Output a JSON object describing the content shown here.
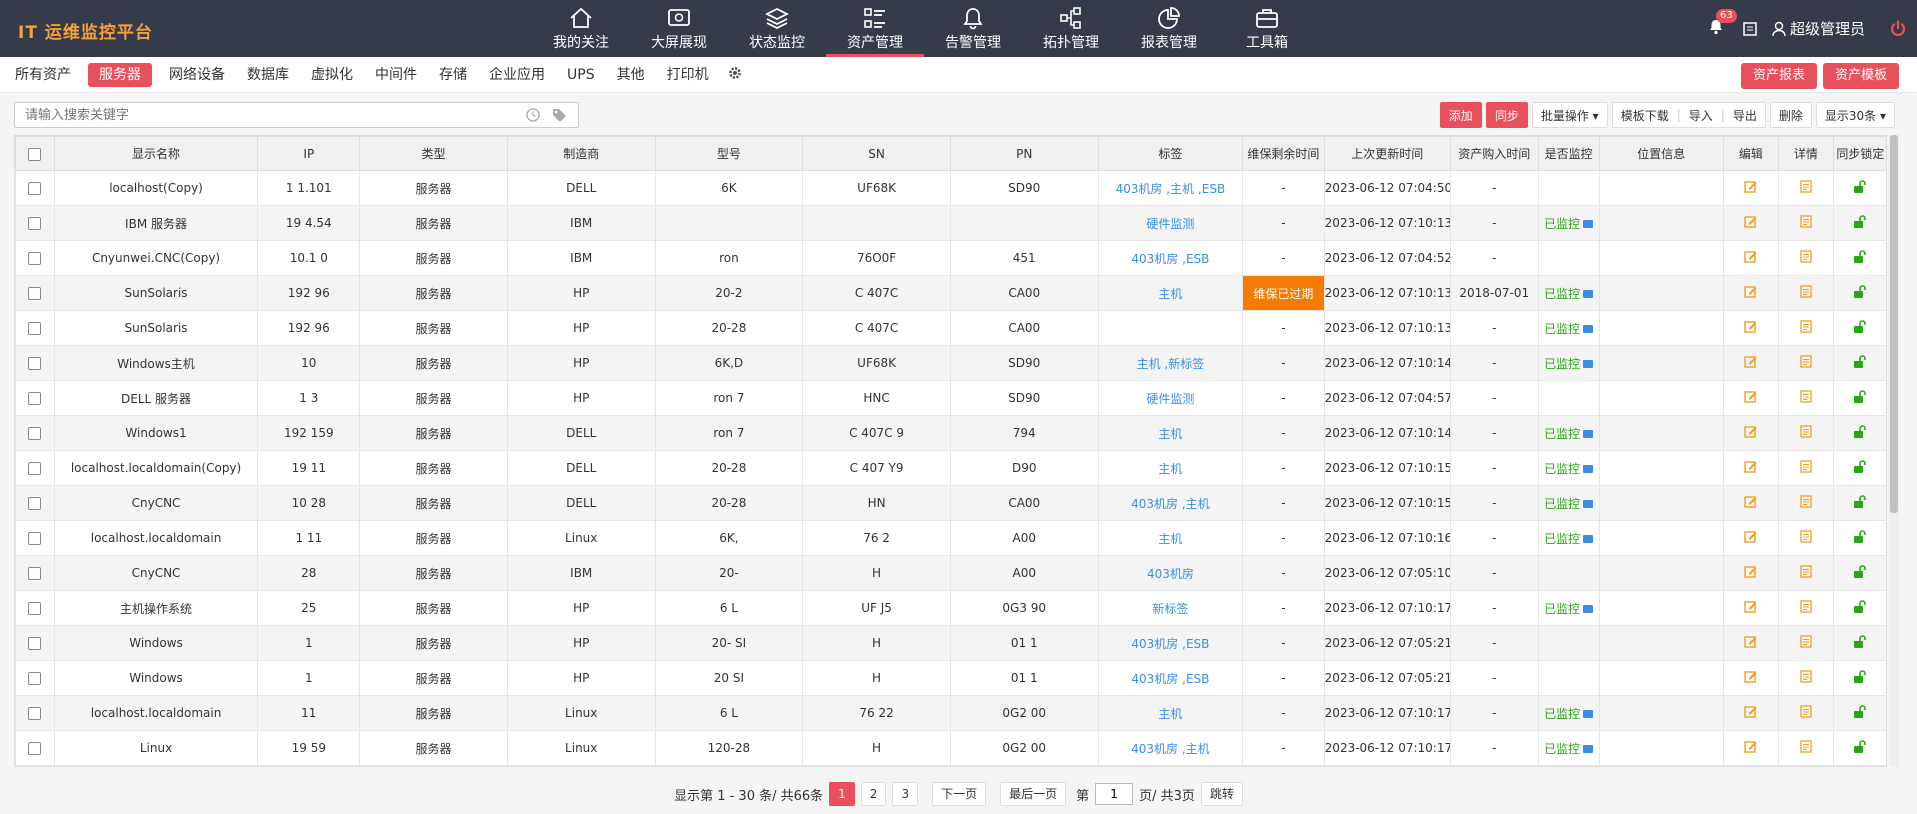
{
  "app": {
    "title": "IT 运维监控平台"
  },
  "nav": [
    {
      "label": "我的关注",
      "icon": "home-icon"
    },
    {
      "label": "大屏展现",
      "icon": "screen-icon"
    },
    {
      "label": "状态监控",
      "icon": "layers-icon"
    },
    {
      "label": "资产管理",
      "icon": "list-icon",
      "active": true
    },
    {
      "label": "告警管理",
      "icon": "bell-icon"
    },
    {
      "label": "拓扑管理",
      "icon": "topology-icon"
    },
    {
      "label": "报表管理",
      "icon": "pie-icon"
    },
    {
      "label": "工具箱",
      "icon": "toolbox-icon"
    }
  ],
  "header": {
    "alert_count": "63",
    "user_name": "超级管理员"
  },
  "categories": [
    "所有资产",
    "服务器",
    "网络设备",
    "数据库",
    "虚拟化",
    "中间件",
    "存储",
    "企业应用",
    "UPS",
    "其他",
    "打印机"
  ],
  "active_category": "服务器",
  "top_buttons": {
    "report": "资产报表",
    "template": "资产模板"
  },
  "search": {
    "placeholder": "请输入搜索关键字"
  },
  "toolbar": {
    "add": "添加",
    "sync": "同步",
    "batch": "批量操作",
    "template_download": "模板下载",
    "import": "导入",
    "export": "导出",
    "delete": "删除",
    "page_size": "显示30条"
  },
  "columns": [
    "显示名称",
    "IP",
    "类型",
    "制造商",
    "型号",
    "SN",
    "PN",
    "标签",
    "维保剩余时间",
    "上次更新时间",
    "资产购入时间",
    "是否监控",
    "位置信息",
    "编辑",
    "详情",
    "同步锁定"
  ],
  "rows": [
    {
      "name": "localhost(Copy)",
      "ip": "1        1.101",
      "type": "服务器",
      "vendor": "DELL",
      "model": "6K",
      "sn": "UF68K",
      "pn": "SD90",
      "tags": "403机房 ,主机 ,ESB",
      "warranty": "-",
      "updated": "2023-06-12 07:04:50",
      "purchased": "-",
      "monitored": ""
    },
    {
      "name": "IBM 服务器",
      "ip": "19       4.54",
      "type": "服务器",
      "vendor": "IBM",
      "model": "",
      "sn": "",
      "pn": "",
      "tags": "硬件监测",
      "warranty": "-",
      "updated": "2023-06-12 07:10:13",
      "purchased": "-",
      "monitored": "已监控"
    },
    {
      "name": "Cnyunwei.CNC(Copy)",
      "ip": "10.1      0",
      "type": "服务器",
      "vendor": "IBM",
      "model": "ron",
      "sn": "76O0F",
      "pn": "451",
      "tags": "403机房 ,ESB",
      "warranty": "-",
      "updated": "2023-06-12 07:04:52",
      "purchased": "-",
      "monitored": ""
    },
    {
      "name": "SunSolaris",
      "ip": "192      96",
      "type": "服务器",
      "vendor": "HP",
      "model": "20-2",
      "sn": "C   407C",
      "pn": "CA00",
      "tags": "主机",
      "warranty": "维保已过期",
      "expired": true,
      "updated": "2023-06-12 07:10:13",
      "purchased": "2018-07-01",
      "monitored": "已监控"
    },
    {
      "name": "SunSolaris",
      "ip": "192      96",
      "type": "服务器",
      "vendor": "HP",
      "model": "20-28",
      "sn": "C   407C",
      "pn": "CA00",
      "tags": "",
      "warranty": "-",
      "updated": "2023-06-12 07:10:13",
      "purchased": "-",
      "monitored": "已监控"
    },
    {
      "name": "Windows主机",
      "ip": "10",
      "type": "服务器",
      "vendor": "HP",
      "model": "6K,D",
      "sn": "UF68K",
      "pn": "SD90",
      "tags": "主机 ,新标签",
      "warranty": "-",
      "updated": "2023-06-12 07:10:14",
      "purchased": "-",
      "monitored": "已监控"
    },
    {
      "name": "DELL 服务器",
      "ip": "1       3",
      "type": "服务器",
      "vendor": "HP",
      "model": "ron 7",
      "sn": "HNC",
      "pn": "SD90",
      "tags": "硬件监测",
      "warranty": "-",
      "updated": "2023-06-12 07:04:57",
      "purchased": "-",
      "monitored": ""
    },
    {
      "name": "Windows1",
      "ip": "192     159",
      "type": "服务器",
      "vendor": "DELL",
      "model": "ron 7",
      "sn": "C   407C   9",
      "pn": "794",
      "tags": "主机",
      "warranty": "-",
      "updated": "2023-06-12 07:10:14",
      "purchased": "-",
      "monitored": "已监控"
    },
    {
      "name": "localhost.localdomain(Copy)",
      "ip": "19      11",
      "type": "服务器",
      "vendor": "DELL",
      "model": "20-28",
      "sn": "C   407   Y9",
      "pn": "D90",
      "tags": "主机",
      "warranty": "-",
      "updated": "2023-06-12 07:10:15",
      "purchased": "-",
      "monitored": "已监控"
    },
    {
      "name": "CnyCNC",
      "ip": "10      28",
      "type": "服务器",
      "vendor": "DELL",
      "model": "20-28",
      "sn": "HN",
      "pn": "CA00",
      "tags": "403机房 ,主机",
      "warranty": "-",
      "updated": "2023-06-12 07:10:15",
      "purchased": "-",
      "monitored": "已监控"
    },
    {
      "name": "localhost.localdomain",
      "ip": "1      11",
      "type": "服务器",
      "vendor": "Linux",
      "model": "6K,",
      "sn": "76   2",
      "pn": "A00",
      "tags": "主机",
      "warranty": "-",
      "updated": "2023-06-12 07:10:16",
      "purchased": "-",
      "monitored": "已监控"
    },
    {
      "name": "CnyCNC",
      "ip": "28",
      "type": "服务器",
      "vendor": "IBM",
      "model": "20-",
      "sn": "H",
      "pn": "A00",
      "tags": "403机房",
      "warranty": "-",
      "updated": "2023-06-12 07:05:10",
      "purchased": "-",
      "monitored": ""
    },
    {
      "name": "主机操作系统",
      "ip": "25",
      "type": "服务器",
      "vendor": "HP",
      "model": "6   L",
      "sn": "UF   J5",
      "pn": "0G3   90",
      "tags": "新标签",
      "warranty": "-",
      "updated": "2023-06-12 07:10:17",
      "purchased": "-",
      "monitored": "已监控"
    },
    {
      "name": "Windows",
      "ip": "1",
      "type": "服务器",
      "vendor": "HP",
      "model": "20-   SI",
      "sn": "H",
      "pn": "01   1",
      "tags": "403机房 ,ESB",
      "warranty": "-",
      "updated": "2023-06-12 07:05:21",
      "purchased": "-",
      "monitored": ""
    },
    {
      "name": "Windows",
      "ip": "1",
      "type": "服务器",
      "vendor": "HP",
      "model": "20   SI",
      "sn": "H",
      "pn": "01   1",
      "tags": "403机房 ,ESB",
      "warranty": "-",
      "updated": "2023-06-12 07:05:21",
      "purchased": "-",
      "monitored": ""
    },
    {
      "name": "localhost.localdomain",
      "ip": "11",
      "type": "服务器",
      "vendor": "Linux",
      "model": "6   L",
      "sn": "76   22",
      "pn": "0G2   00",
      "tags": "主机",
      "warranty": "-",
      "updated": "2023-06-12 07:10:17",
      "purchased": "-",
      "monitored": "已监控"
    },
    {
      "name": "Linux",
      "ip": "19     59",
      "type": "服务器",
      "vendor": "Linux",
      "model": "120-28",
      "sn": "H",
      "pn": "0G2   00",
      "tags": "403机房 ,主机",
      "warranty": "-",
      "updated": "2023-06-12 07:10:17",
      "purchased": "-",
      "monitored": "已监控"
    }
  ],
  "pager": {
    "summary": "显示第 1 - 30 条/ 共66条",
    "pages": [
      "1",
      "2",
      "3"
    ],
    "next": "下一页",
    "last": "最后一页",
    "goto_prefix": "第",
    "goto_value": "1",
    "goto_suffix": "页/ 共3页",
    "jump": "跳转"
  },
  "colors": {
    "accent": "#e8505b",
    "nav_bg": "#353b48",
    "logo": "#f6a038",
    "link": "#3a8ee6",
    "monitored": "#2aa515",
    "expired": "#f57c00"
  }
}
